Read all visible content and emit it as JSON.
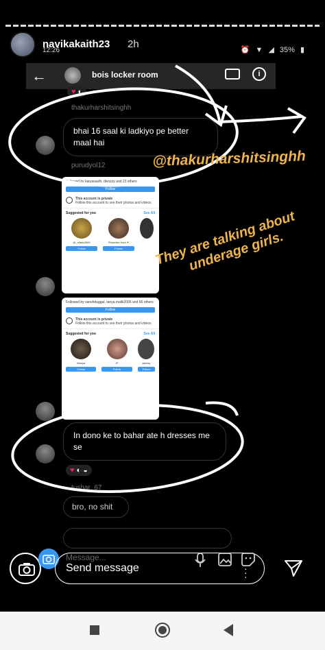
{
  "story": {
    "username": "navikakaith23",
    "time_ago": "2h"
  },
  "status_bar": {
    "clock": "12:26",
    "battery": "35%"
  },
  "dm": {
    "title": "bois locker room",
    "messages": [
      {
        "sender": "thakurharshitsinghh",
        "text": "bhai 16 saal ki ladkiyo pe better maal hai"
      },
      {
        "sender": "purudyol12",
        "text": ""
      },
      {
        "sender": "",
        "text": "In dono ke to bahar ate h dresses me se"
      },
      {
        "sender": "tushar_67",
        "text": "bro, no shit"
      }
    ]
  },
  "shared_cards": [
    {
      "followed_by": "Followed by karyasaxth, divozzy and 23 others",
      "follow": "Follow",
      "private_title": "This account is private",
      "private_sub": "Follow this account to see their photos and videos",
      "suggested": "Suggested for you",
      "see_all": "See All",
      "people": [
        {
          "name": "@_sifalis2669",
          "follow": "Follow"
        },
        {
          "name": "Rhavnika Kaul ✦",
          "follow": "Follow"
        },
        {
          "name": "",
          "follow": ""
        }
      ]
    },
    {
      "followed_by": "Followed by sanshduggal, tanya.malik2006 and 66 others",
      "follow": "Follow",
      "private_title": "This account is private",
      "private_sub": "Follow this account to see their photos and videos",
      "suggested": "Suggested for you",
      "see_all": "See All",
      "people": [
        {
          "name": "Manya",
          "follow": "Follow"
        },
        {
          "name": "JF",
          "follow": "Follow"
        },
        {
          "name": "jaivery",
          "follow": "Follow"
        }
      ]
    }
  ],
  "overlays": {
    "mention": "@thakurharshitsinghh",
    "caption_line1": "They are talking about",
    "caption_line2": "underage girls."
  },
  "composer": {
    "ghost_placeholder": "Message...",
    "label": "Send message"
  },
  "colors": {
    "accent_blue": "#3897f0",
    "caption": "#f0b44c"
  }
}
